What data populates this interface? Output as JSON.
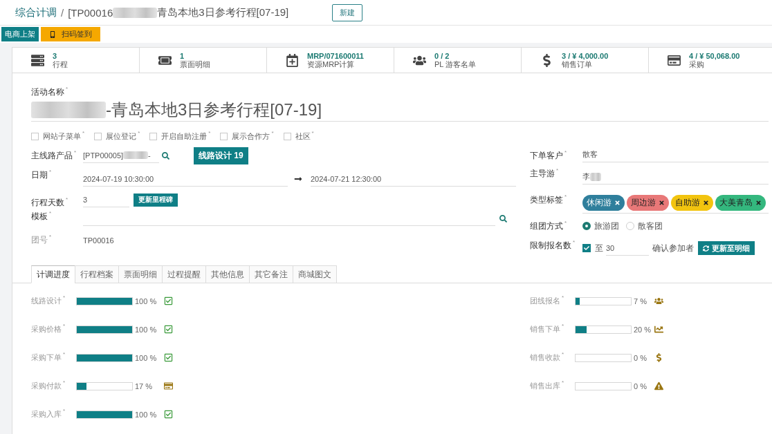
{
  "breadcrumb": {
    "parent": "综合计调",
    "separator": "/",
    "parts": [
      {
        "kind": "text",
        "text": "[TP00016"
      },
      {
        "kind": "blur"
      },
      {
        "kind": "text",
        "text": "青岛本地3日参考行程[07-19]"
      }
    ]
  },
  "new_button": "新建",
  "action_buttons": [
    {
      "kind": "primary",
      "label": "电商上架"
    },
    {
      "kind": "warning",
      "label": "扫码签到"
    }
  ],
  "stat_buttons": [
    {
      "kind": "itinerary",
      "value": "3",
      "label": "行程"
    },
    {
      "kind": "ticket",
      "value": "1",
      "label": "票面明细"
    },
    {
      "kind": "mrp",
      "value": "MRP/071600011",
      "label": "资源MRP计算"
    },
    {
      "kind": "guests",
      "value": "0 / 2",
      "label": "PL 游客名单"
    },
    {
      "kind": "sales",
      "value": "3 / ¥ 4,000.00",
      "label": "销售订单"
    },
    {
      "kind": "purchase",
      "value": "4 / ¥ 50,068.00",
      "label": "采购"
    }
  ],
  "activity": {
    "label": "活动名称$^{*}$",
    "name": [
      {
        "kind": "blur"
      },
      {
        "kind": "text",
        "text": "-青岛本地3日参考行程[07-19]"
      }
    ]
  },
  "checkboxes": [
    {
      "label": "网站子菜单$^{*}$",
      "checked": false
    },
    {
      "label": "展位登记$^{*}$",
      "checked": false
    },
    {
      "label": "开启自助注册$^{*}$",
      "checked": false
    },
    {
      "label": "展示合作方$^{*}$",
      "checked": false
    },
    {
      "label": "社区$^{*}$",
      "checked": false
    }
  ],
  "product": {
    "label": "主线路产品$^{*}$",
    "value": [
      {
        "kind": "text",
        "text": "[PTP00005]"
      },
      {
        "kind": "blur"
      },
      {
        "kind": "text",
        "text": "-"
      }
    ],
    "button": "线路设计 19"
  },
  "date": {
    "label": "日期$^{*}$",
    "start": "2024-07-19 10:30:00",
    "end": "2024-07-21 12:30:00"
  },
  "days": {
    "label": "行程天数$^{*}$",
    "value": "3",
    "button": "更新里程碑"
  },
  "template": {
    "label": "模板$^{*}$"
  },
  "group_no": {
    "label": "团号$^{*}$",
    "value": "TP00016",
    "readonly": true
  },
  "customer": {
    "label": "下单客户$^{*}$",
    "value": "散客"
  },
  "guide": {
    "label": "主导游$^{*}$",
    "value": [
      {
        "kind": "text",
        "text": "李"
      },
      {
        "kind": "blur"
      }
    ]
  },
  "tags": {
    "label": "类型标签$^{*}$",
    "items": [
      {
        "text": "休闲游",
        "color": "#2f7f9c"
      },
      {
        "text": "周边游",
        "color": "#e87878"
      },
      {
        "text": "自助游",
        "color": "#f2c40f"
      },
      {
        "text": "大美青岛",
        "color": "#34b77e"
      }
    ]
  },
  "group_mode": {
    "label": "组团方式$^{*}$",
    "options": [
      {
        "label": "旅游团",
        "selected": true
      },
      {
        "label": "散客团",
        "selected": false
      }
    ]
  },
  "limit": {
    "label": "限制报名数$^{*}$",
    "checked": true,
    "prefix": "至",
    "value": "30",
    "confirm": "确认参加者",
    "button": "更新至明细"
  },
  "tabs": [
    {
      "label": "计调进度",
      "selected": true
    },
    {
      "label": "行程档案",
      "selected": false
    },
    {
      "label": "票面明细",
      "selected": false
    },
    {
      "label": "过程提醒",
      "selected": false
    },
    {
      "label": "其他信息",
      "selected": false
    },
    {
      "label": "其它备注",
      "selected": false
    },
    {
      "label": "商城图文",
      "selected": false
    }
  ],
  "progress_left": [
    {
      "label": "线路设计$^{*}$",
      "level": 1,
      "reading": "100 %",
      "kind": "done"
    },
    {
      "label": "采购价格$^{*}$",
      "level": 1,
      "reading": "100 %",
      "kind": "done"
    },
    {
      "label": "采购下单$^{*}$",
      "level": 1,
      "reading": "100 %",
      "kind": "done"
    },
    {
      "label": "采购付款$^{*}$",
      "level": 0.17,
      "reading": "17 %",
      "kind": "payment"
    },
    {
      "label": "采购入库$^{*}$",
      "level": 1,
      "reading": "100 %",
      "kind": "done"
    }
  ],
  "progress_right": [
    {
      "label": "团线报名$^{*}$",
      "level": 0.07,
      "reading": "7 %",
      "kind": "signup"
    },
    {
      "label": "销售下单$^{*}$",
      "level": 0.2,
      "reading": "20 %",
      "kind": "trend"
    },
    {
      "label": "销售收款$^{*}$",
      "level": 0,
      "reading": "0 %",
      "kind": "receipt"
    },
    {
      "label": "销售出库$^{*}$",
      "level": 0,
      "reading": "0 %",
      "kind": "warning"
    }
  ]
}
